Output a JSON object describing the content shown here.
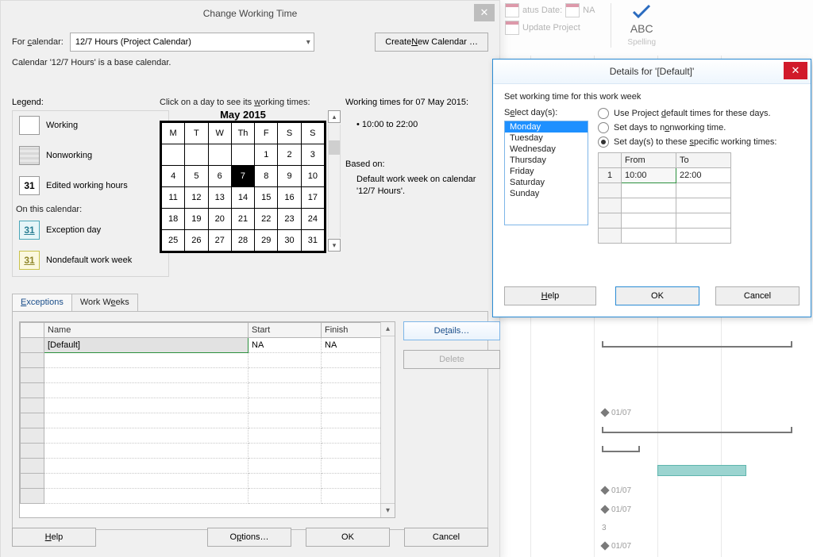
{
  "bg_ribbon": {
    "status_date_label": "atus Date:",
    "status_na": "NA",
    "update_project": "Update Project",
    "spelling": "Spelling"
  },
  "gantt": {
    "tick_dates": [
      "01/07",
      "01/07",
      "01/07",
      "01/07"
    ],
    "extra_tick": "3"
  },
  "cwt": {
    "title": "Change Working Time",
    "for_calendar_label": "For calendar:",
    "for_calendar_value": "12/7 Hours (Project Calendar)",
    "create_new_btn": "Create New Calendar …",
    "base_msg": "Calendar '12/7 Hours' is a base calendar.",
    "legend": {
      "title": "Legend:",
      "working": "Working",
      "nonworking": "Nonworking",
      "edited": "Edited working hours",
      "edited_num": "31",
      "on_this": "On this calendar:",
      "exception": "Exception day",
      "ex_num": "31",
      "nondef": "Nondefault work week",
      "nd_num": "31"
    },
    "calendar": {
      "click_hint": "Click on a day to see its working times:",
      "month": "May 2015",
      "dow": [
        "M",
        "T",
        "W",
        "Th",
        "F",
        "S",
        "S"
      ],
      "weeks": [
        [
          "",
          "",
          "",
          "",
          "1",
          "2",
          "3"
        ],
        [
          "4",
          "5",
          "6",
          "7",
          "8",
          "9",
          "10"
        ],
        [
          "11",
          "12",
          "13",
          "14",
          "15",
          "16",
          "17"
        ],
        [
          "18",
          "19",
          "20",
          "21",
          "22",
          "23",
          "24"
        ],
        [
          "25",
          "26",
          "27",
          "28",
          "29",
          "30",
          "31"
        ]
      ],
      "selected": "7"
    },
    "wt": {
      "heading": "Working times for 07 May 2015:",
      "bullet": "• 10:00 to 22:00",
      "based": "Based on:",
      "based_text": "Default work week on calendar '12/7 Hours'."
    },
    "tabs": {
      "exceptions": "Exceptions",
      "work_weeks": "Work Weeks"
    },
    "grid": {
      "cols": {
        "name": "Name",
        "start": "Start",
        "finish": "Finish"
      },
      "row": {
        "name": "[Default]",
        "start": "NA",
        "finish": "NA"
      }
    },
    "side": {
      "details": "Details…",
      "delete": "Delete"
    },
    "bottom": {
      "help": "Help",
      "options": "Options…",
      "ok": "OK",
      "cancel": "Cancel"
    }
  },
  "details": {
    "title": "Details for '[Default]'",
    "set_hint": "Set working time for this work week",
    "select_days": "Select day(s):",
    "days": [
      "Monday",
      "Tuesday",
      "Wednesday",
      "Thursday",
      "Friday",
      "Saturday",
      "Sunday"
    ],
    "radios": {
      "default": "Use Project default times for these days.",
      "nonworking": "Set days to nonworking time.",
      "specific": "Set day(s) to these specific working times:"
    },
    "time_hdr": {
      "from": "From",
      "to": "To"
    },
    "row1": {
      "num": "1",
      "from": "10:00",
      "to": "22:00"
    },
    "btns": {
      "help": "Help",
      "ok": "OK",
      "cancel": "Cancel"
    }
  }
}
